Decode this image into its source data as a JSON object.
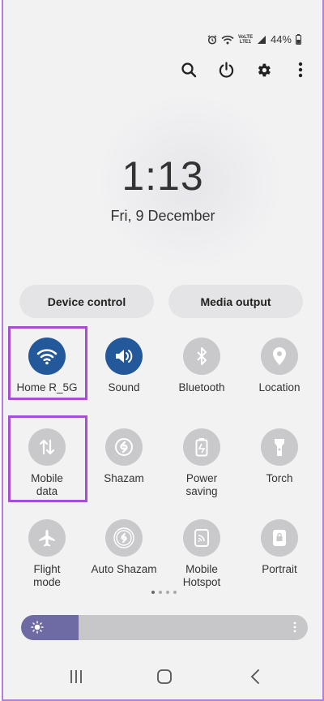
{
  "status_bar": {
    "battery_text": "44%",
    "network_label": "VoLTE LTE1"
  },
  "clock": {
    "time": "1:13",
    "date": "Fri, 9 December"
  },
  "top_actions": [
    {
      "icon": "search-icon"
    },
    {
      "icon": "power-icon"
    },
    {
      "icon": "gear-icon"
    },
    {
      "icon": "more-vert-icon"
    }
  ],
  "buttons": {
    "device_control": "Device control",
    "media_output": "Media output"
  },
  "tiles": {
    "home_r_5g": "Home R_5G",
    "sound": "Sound",
    "bluetooth": "Bluetooth",
    "location": "Location",
    "mobile_data": "Mobile\ndata",
    "shazam": "Shazam",
    "power_saving": "Power\nsaving",
    "torch": "Torch",
    "flight_mode": "Flight\nmode",
    "auto_shazam": "Auto Shazam",
    "mobile_hotspot": "Mobile\nHotspot",
    "portrait": "Portrait"
  },
  "pager": {
    "pages": 4,
    "active": 1
  },
  "brightness": {
    "level": 0.2
  },
  "colors": {
    "accent": "#23589a",
    "highlight": "#a64fd6",
    "brightness_fill": "#6e6aa3"
  }
}
